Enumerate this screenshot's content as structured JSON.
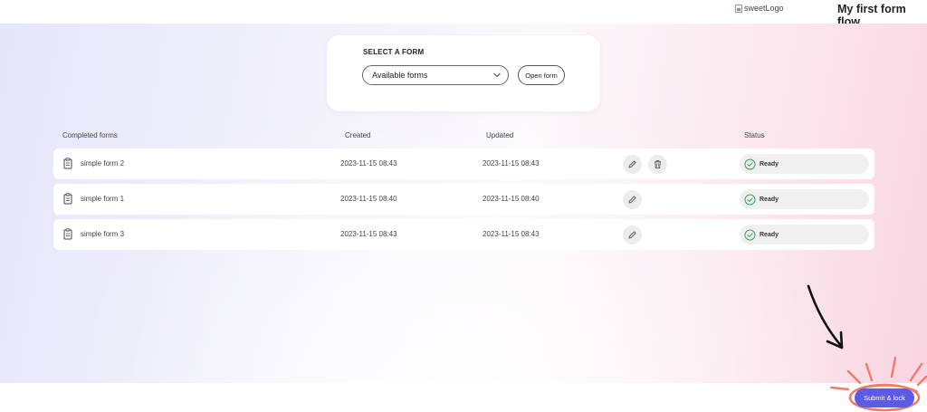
{
  "header": {
    "logo_alt": "sweetLogo",
    "title": "My first form flow"
  },
  "select_form": {
    "title": "SELECT A FORM",
    "dropdown_value": "Available forms",
    "open_label": "Open form"
  },
  "table": {
    "columns": {
      "name": "Completed forms",
      "created": "Created",
      "updated": "Updated",
      "status": "Status"
    },
    "rows": [
      {
        "name": "simple form 2",
        "created": "2023-11-15 08:43",
        "updated": "2023-11-15 08:43",
        "status": "Ready",
        "has_delete": true
      },
      {
        "name": "simple form 1",
        "created": "2023-11-15 08:40",
        "updated": "2023-11-15 08:40",
        "status": "Ready",
        "has_delete": false
      },
      {
        "name": "simple form 3",
        "created": "2023-11-15 08:43",
        "updated": "2023-11-15 08:43",
        "status": "Ready",
        "has_delete": false
      }
    ]
  },
  "footer": {
    "submit_label": "Submit & lock"
  },
  "colors": {
    "accent": "#5b5be6",
    "annotation": "#f07b6b",
    "status_ok": "#3aa35a"
  },
  "icons": {
    "row": "clipboard-icon",
    "edit": "pencil-icon",
    "delete": "trash-icon",
    "status": "check-circle-icon",
    "dropdown": "chevron-down-icon"
  }
}
